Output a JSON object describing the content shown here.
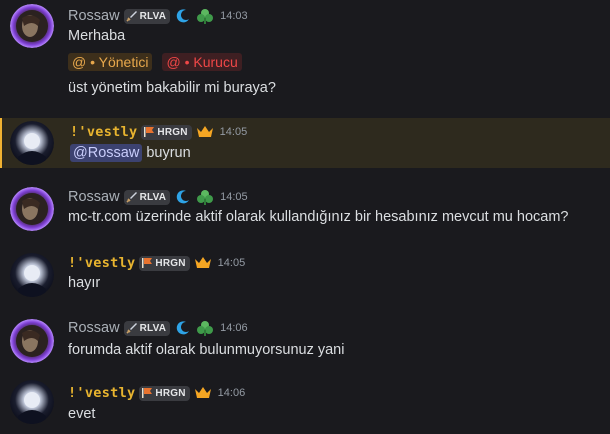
{
  "users": {
    "rossaw": {
      "name": "Rossaw",
      "tag": "RLVA"
    },
    "ivestly": {
      "name": "!'vestly",
      "tag": "HRGN"
    }
  },
  "messages": [
    {
      "author": "Rossaw",
      "time": "14:03",
      "lines": [
        "Merhaba",
        "",
        "üst yönetim bakabilir mi buraya?"
      ],
      "role_mentions": [
        "@ • Yönetici",
        "@ • Kurucu"
      ]
    },
    {
      "author": "!'vestly",
      "time": "14:05",
      "mention": "@Rossaw",
      "text": "buyrun"
    },
    {
      "author": "Rossaw",
      "time": "14:05",
      "text": "mc-tr.com üzerinde aktif olarak kullandığınız bir hesabınız mevcut mu hocam?"
    },
    {
      "author": "!'vestly",
      "time": "14:05",
      "text": "hayır"
    },
    {
      "author": "Rossaw",
      "time": "14:06",
      "text": "forumda aktif olarak bulunmuyorsunuz yani"
    },
    {
      "author": "!'vestly",
      "time": "14:06",
      "text": "evet"
    }
  ],
  "colors": {
    "background": "#1a1a1e",
    "mention_highlight": "#2e2a1e",
    "ivestly_name": "#e8b42f",
    "rossaw_name": "#aab0b7"
  },
  "icons": {
    "rossaw_badges": [
      "sword-icon",
      "moon-icon",
      "leaf-icon"
    ],
    "ivestly_badges": [
      "flag-icon",
      "crown-icon"
    ]
  }
}
